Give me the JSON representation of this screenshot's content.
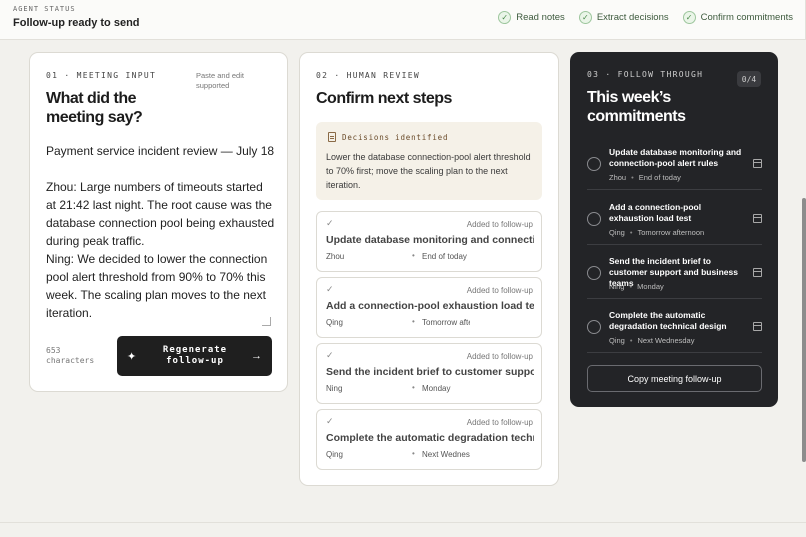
{
  "topbar": {
    "eyebrow": "AGENT STATUS",
    "status": "Follow-up ready to send",
    "steps": [
      {
        "label": "Read notes",
        "icon": "check-icon"
      },
      {
        "label": "Extract decisions",
        "icon": "check-icon"
      },
      {
        "label": "Confirm commitments",
        "icon": "check-icon"
      }
    ]
  },
  "input": {
    "label": "01 · MEETING INPUT",
    "title": "What did the meeting say?",
    "side_note": "Paste and edit supported",
    "heading_line": "Payment service incident review — July 18",
    "body_text": "Zhou: Large numbers of timeouts started at 21:42 last night. The root cause was the database connection pool being exhausted during peak traffic.\nNing: We decided to lower the connection pool alert threshold from 90% to 70% this week. The scaling plan moves to the next iteration.\nZhou: I will update database monitoring and",
    "char_count": "653",
    "char_unit": "characters",
    "regen_label": "Regenerate follow-up",
    "regen_icon": "sparkle-icon",
    "arrow_icon": "arrow-right-icon"
  },
  "review": {
    "label": "02 · HUMAN REVIEW",
    "title": "Confirm next steps",
    "decisions_header": "Decisions identified",
    "decisions_icon": "document-icon",
    "decisions_text": "Lower the database connection-pool alert threshold to 70% first; move the scaling plan to the next iteration.",
    "items": [
      {
        "added": "Added to follow-up",
        "title": "Update database monitoring and connection-pool alert rules",
        "owner": "Zhou",
        "due": "End of today"
      },
      {
        "added": "Added to follow-up",
        "title": "Add a connection-pool exhaustion load test",
        "owner": "Qing",
        "due": "Tomorrow afternoon"
      },
      {
        "added": "Added to follow-up",
        "title": "Send the incident brief to customer support and business teams",
        "owner": "Ning",
        "due": "Monday"
      },
      {
        "added": "Added to follow-up",
        "title": "Complete the automatic degradation technical design",
        "owner": "Qing",
        "due": "Next Wednesday"
      }
    ]
  },
  "follow": {
    "label": "03 · FOLLOW THROUGH",
    "count": "0/4",
    "title": "This week’s commitments",
    "items": [
      {
        "title": "Update database monitoring and connection-pool alert rules",
        "owner": "Zhou",
        "due": "End of today"
      },
      {
        "title": "Add a connection-pool exhaustion load test",
        "owner": "Qing",
        "due": "Tomorrow afternoon"
      },
      {
        "title": "Send the incident brief to customer support and business teams",
        "owner": "Ning",
        "due": "Monday"
      },
      {
        "title": "Complete the automatic degradation technical design",
        "owner": "Qing",
        "due": "Next Wednesday"
      }
    ],
    "copy_label": "Copy meeting follow-up"
  }
}
